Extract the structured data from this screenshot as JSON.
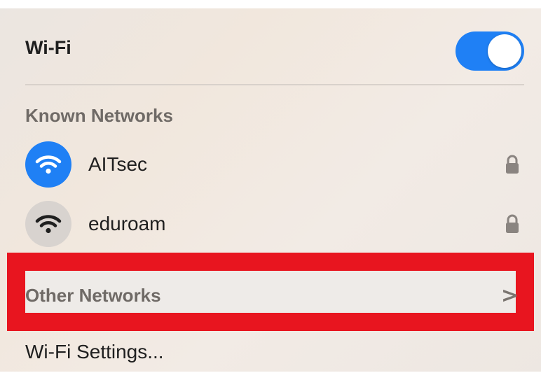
{
  "wifi": {
    "title": "Wi-Fi",
    "enabled": true
  },
  "known_networks": {
    "label": "Known Networks",
    "items": [
      {
        "name": "AITsec",
        "connected": true,
        "secured": true,
        "icon": "wifi-icon"
      },
      {
        "name": "eduroam",
        "connected": false,
        "secured": true,
        "icon": "wifi-icon"
      }
    ]
  },
  "other_networks": {
    "label": "Other Networks",
    "chevron": ">"
  },
  "settings": {
    "label": "Wi-Fi Settings..."
  },
  "colors": {
    "accent": "#1f80f5",
    "highlight": "#e8151f"
  }
}
